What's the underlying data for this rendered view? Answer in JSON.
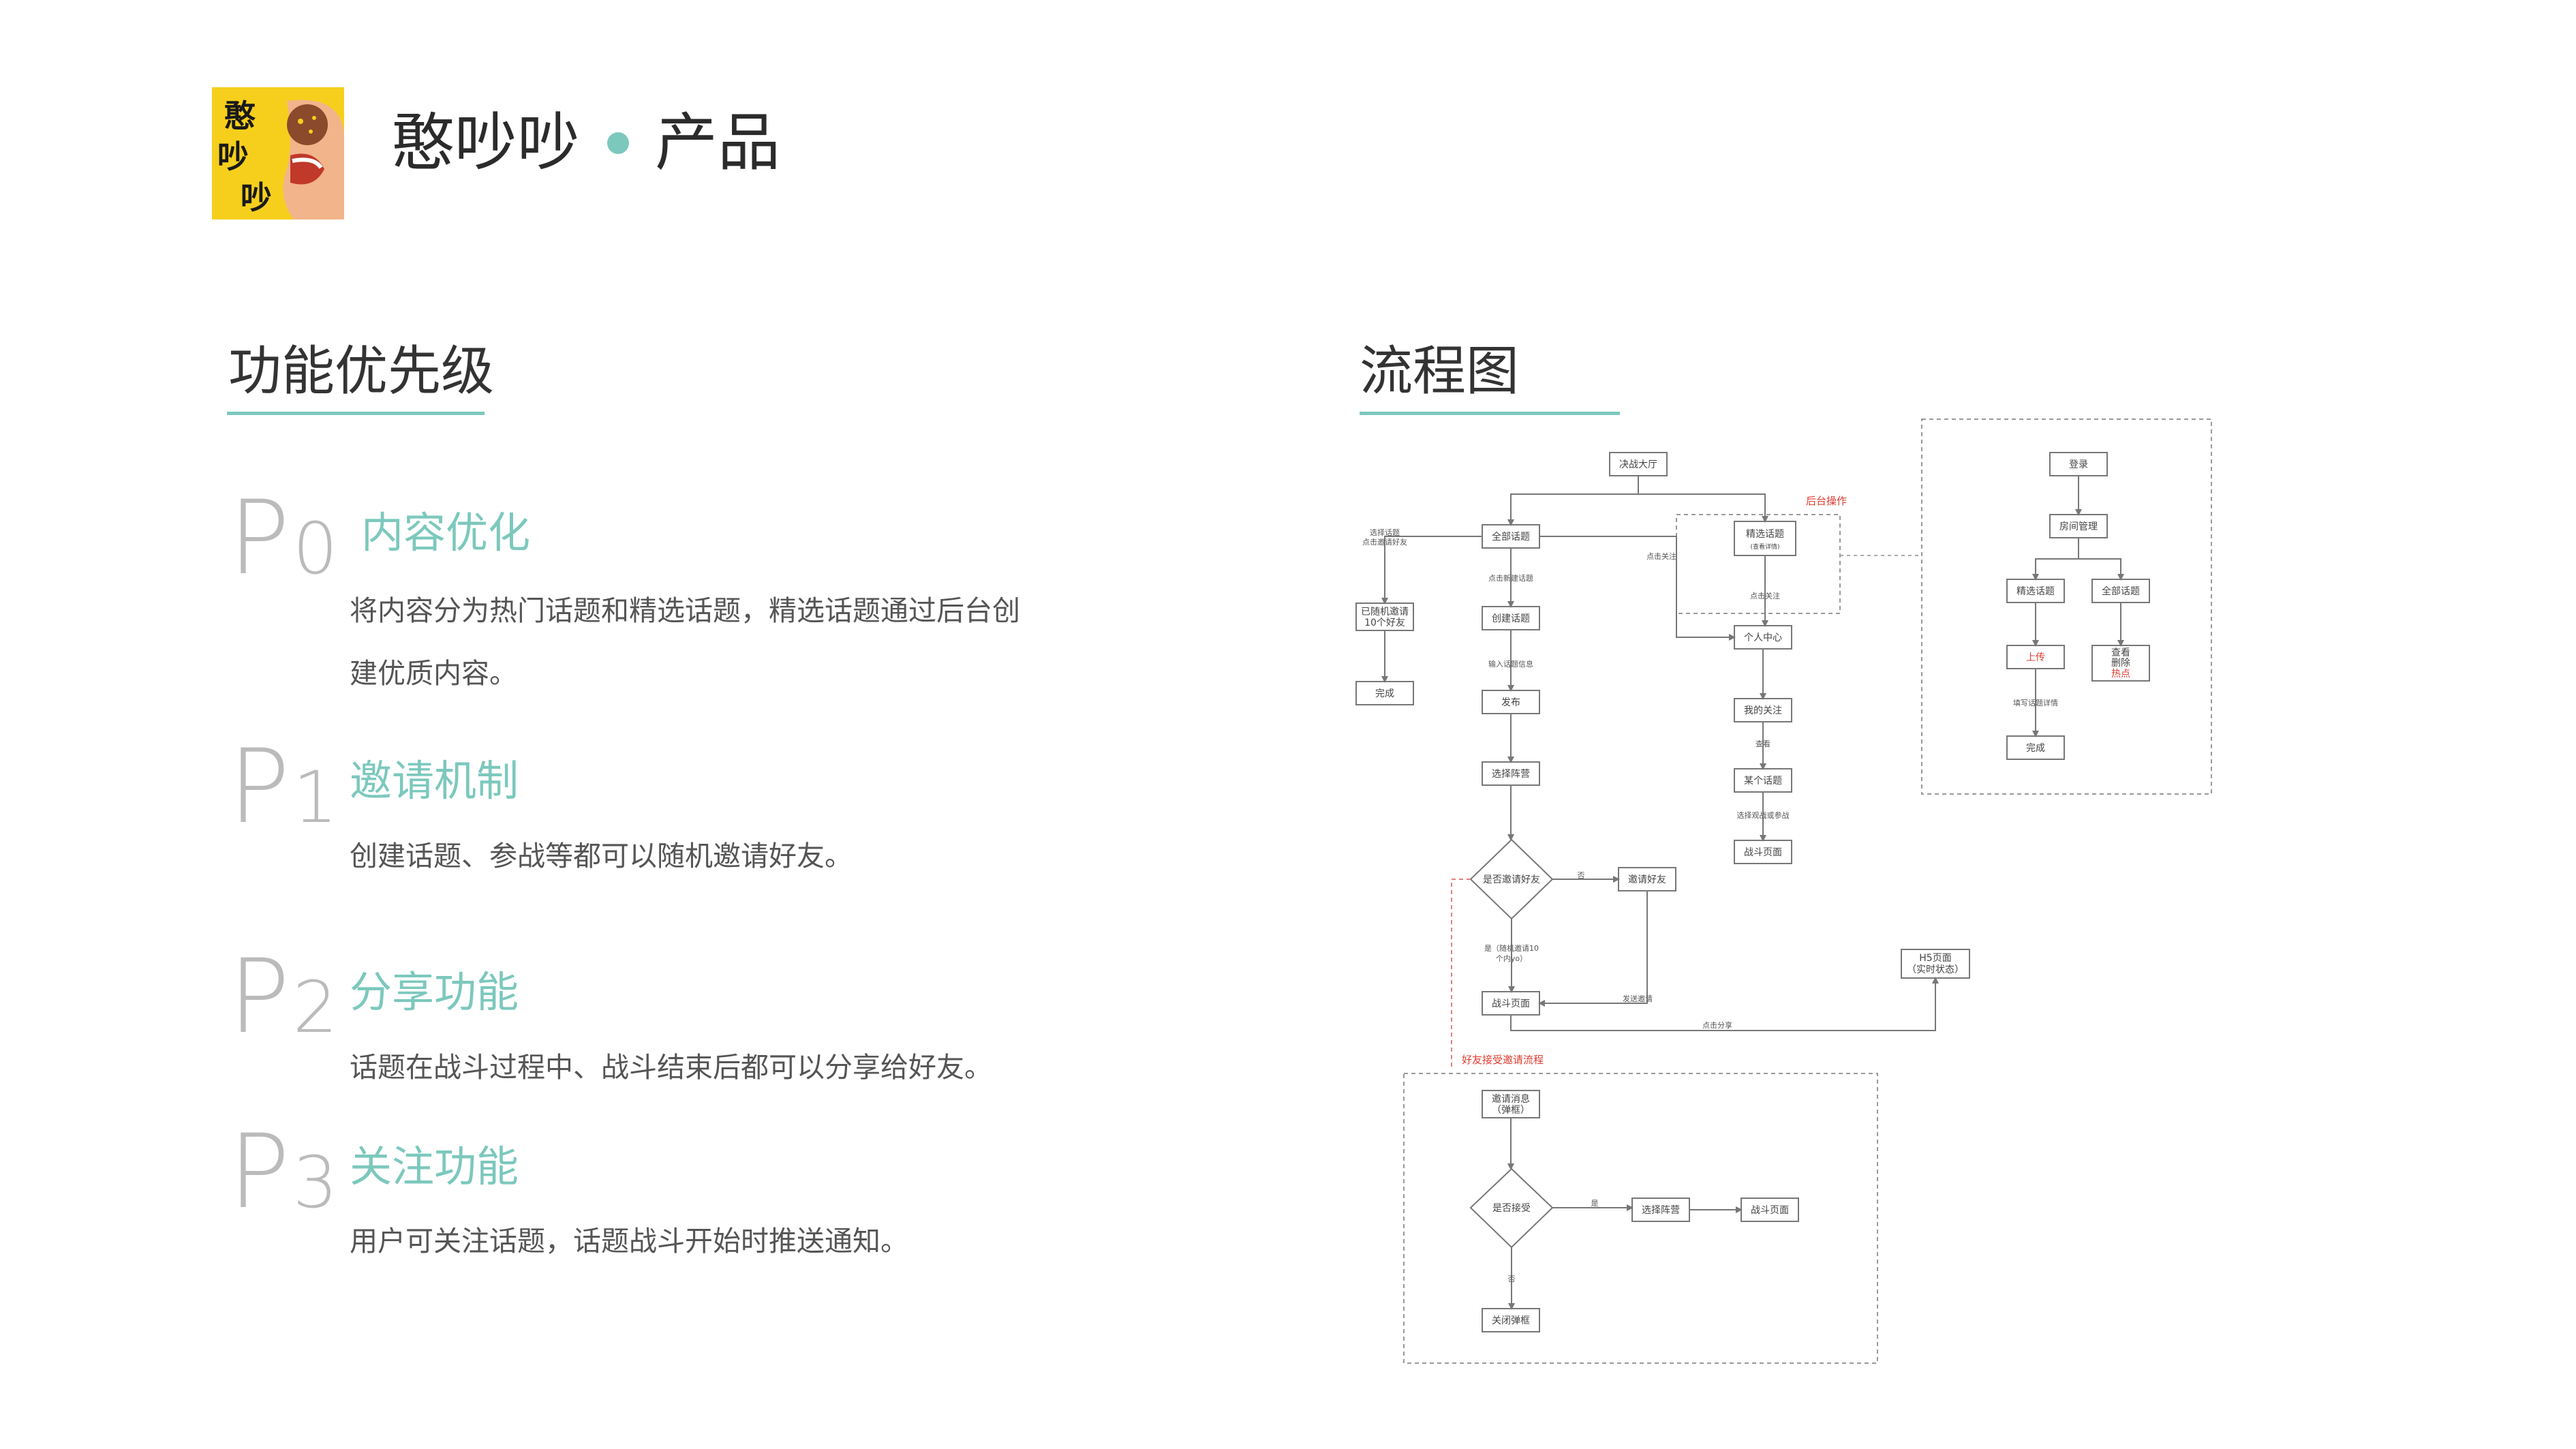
{
  "header": {
    "logo_text": [
      "憨",
      "吵",
      "吵"
    ],
    "app_name": "憨吵吵",
    "section": "产品"
  },
  "colors": {
    "accent": "#7cc8bd",
    "logo_bg": "#f6cf1d",
    "red_note": "#e03c31",
    "code_gray": "#bbbbbb"
  },
  "left": {
    "title": "功能优先级",
    "items": [
      {
        "code": "P",
        "num": "0",
        "title": "内容优化",
        "desc": [
          "将内容分为热门话题和精选话题，精选话题通过后台创",
          "建优质内容。"
        ]
      },
      {
        "code": "P",
        "num": "1",
        "title": "邀请机制",
        "desc": [
          "创建话题、参战等都可以随机邀请好友。"
        ]
      },
      {
        "code": "P",
        "num": "2",
        "title": "分享功能",
        "desc": [
          "话题在战斗过程中、战斗结束后都可以分享给好友。"
        ]
      },
      {
        "code": "P",
        "num": "3",
        "title": "关注功能",
        "desc": [
          "用户可关注话题，话题战斗开始时推送通知。"
        ]
      }
    ]
  },
  "right": {
    "title": "流程图",
    "flow": {
      "nodes": {
        "hall": "决战大厅",
        "all_topics": "全部话题",
        "featured": "精选话题",
        "featured_sub": "(查看详情)",
        "random_left_1": "已随机邀请",
        "random_left_2": "10个好友",
        "done_left": "完成",
        "create": "创建话题",
        "publish": "发布",
        "choose_side": "选择阵营",
        "invite_q": "是否邀请好友",
        "invite_friend": "邀请好友",
        "battle": "战斗页面",
        "h5_1": "H5页面",
        "h5_2": "（实时状态）",
        "personal": "个人中心",
        "my_follow": "我的关注",
        "some_topic": "某个话题",
        "battle_r": "战斗页面",
        "login": "登录",
        "room_mgmt": "房间管理",
        "adm_featured": "精选话题",
        "adm_all": "全部话题",
        "upload": "上传",
        "view": "查看",
        "delete": "删除",
        "hot": "热点",
        "adm_done": "完成",
        "invite_msg_1": "邀请消息",
        "invite_msg_2": "（弹框）",
        "accept_q": "是否接受",
        "choose_side_2": "选择阵营",
        "battle_2": "战斗页面",
        "close_popup": "关闭弹框"
      },
      "labels": {
        "choose_topic_1": "选择话题",
        "choose_topic_2": "点击邀请好友",
        "click_create": "点击新建话题",
        "input_info": "输入话题信息",
        "click_follow": "点击关注",
        "click_follow_2": "点击关注",
        "view_lbl": "查看",
        "choose_join": "选择观战或参战",
        "no": "否",
        "yes_random_1": "是（随机邀请10",
        "yes_random_2": "个内yo）",
        "send_invite": "发送邀请",
        "click_share": "点击分享",
        "fill_detail": "填写话题详情",
        "yes": "是",
        "no2": "否",
        "backend": "后台操作",
        "friend_flow": "好友接受邀请流程"
      }
    }
  }
}
